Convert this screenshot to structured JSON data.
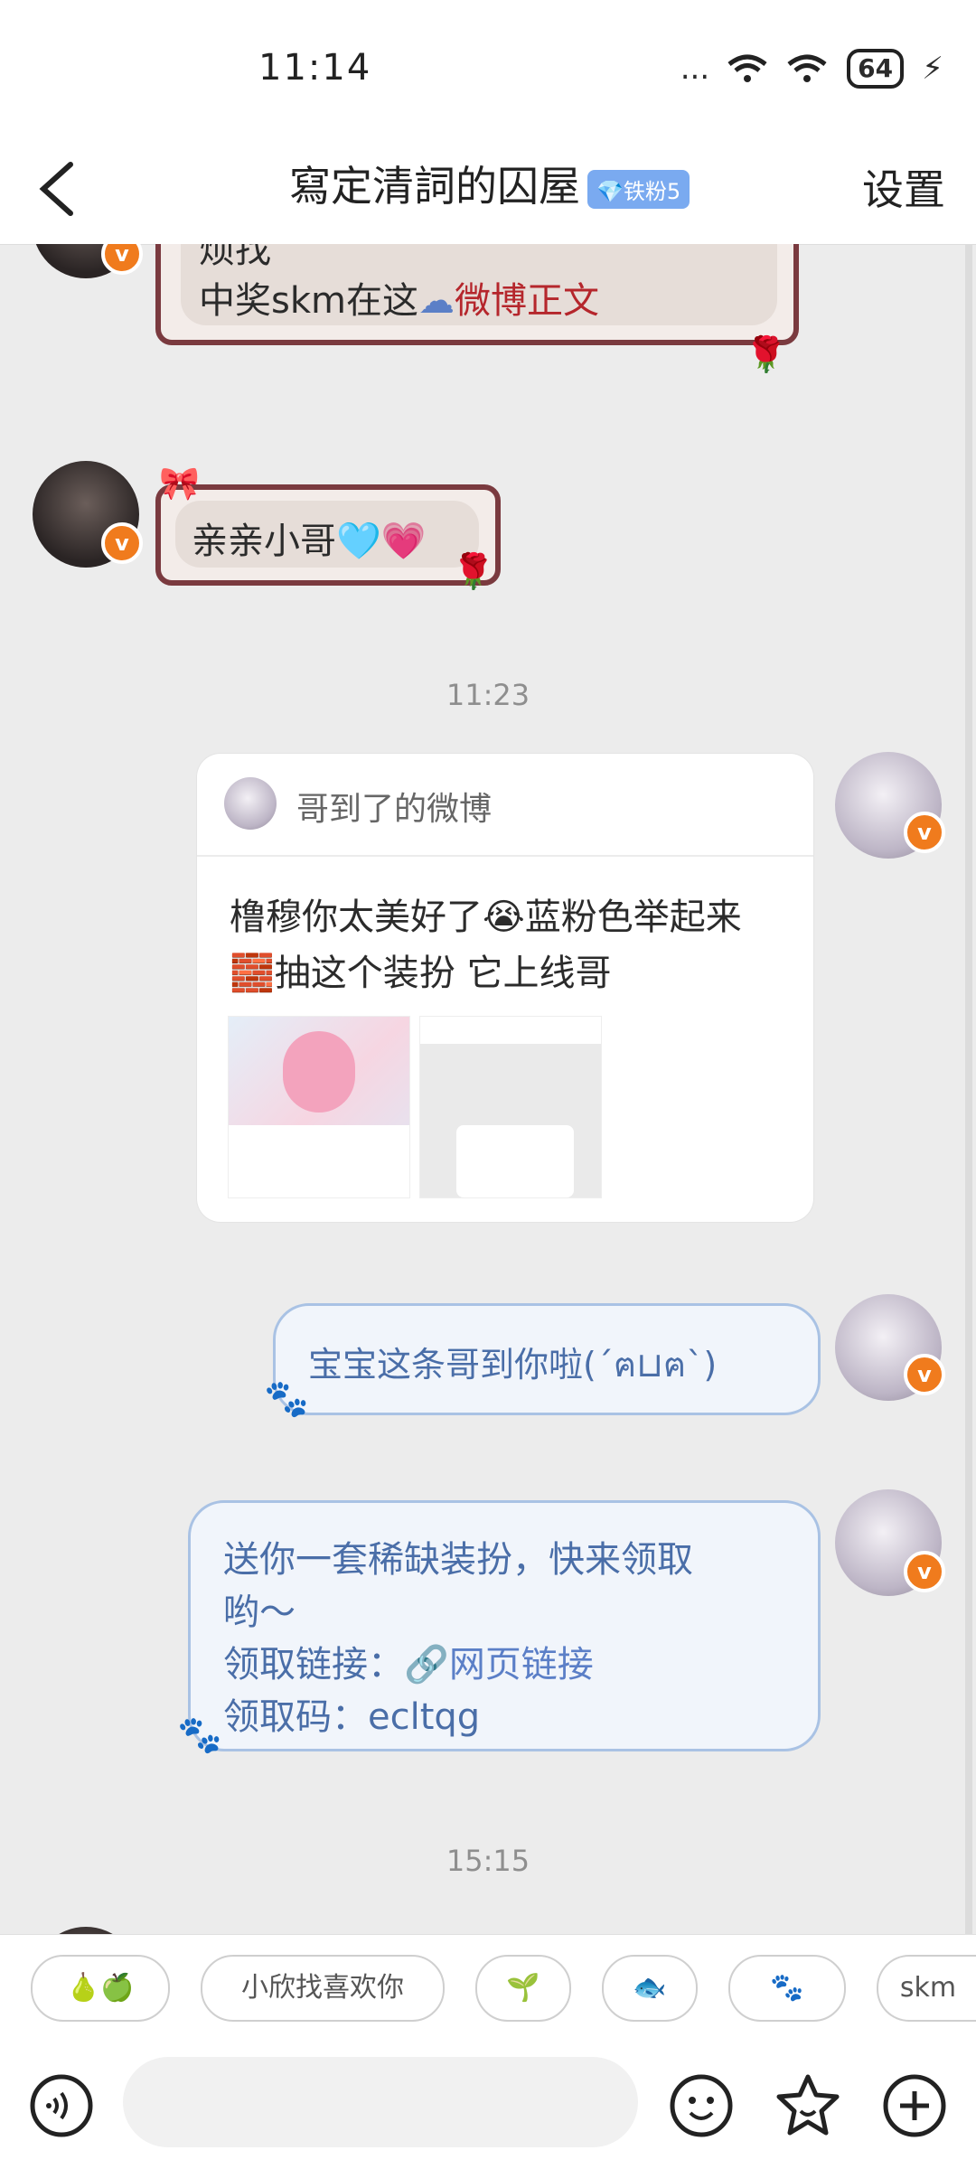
{
  "status_bar": {
    "time": "11:14",
    "dots": "...",
    "battery": "64"
  },
  "header": {
    "title": "寫定清詞的囚屋",
    "badge": "铁粉5",
    "settings_label": "设置"
  },
  "messages": {
    "prev_frame": {
      "line1": "烦找",
      "line2": "中奖skm在这",
      "link": "微博正文"
    },
    "reply_frame": {
      "text": "亲亲小哥",
      "emoji": "🩵💗"
    },
    "timestamp_1": "11:23",
    "shared_post": {
      "header": "哥到了的微博",
      "text_line1": "橹穆你太美好了😭蓝粉色举起来",
      "text_line2": "🧱抽这个装扮 它上线哥"
    },
    "bubble_1": {
      "text": "宝宝这条哥到你啦(´ฅ⊔ฅ`)"
    },
    "bubble_2": {
      "line1": "送你一套稀缺装扮，快来领取",
      "line2": "哟～",
      "link_label": "领取链接：",
      "link_text": "网页链接",
      "code_label": "领取码：",
      "code": "ecltqg"
    },
    "timestamp_2": "15:15"
  },
  "quick_replies": [
    "🍐🍏",
    "小欣找喜欢你",
    "🌱",
    "🐟",
    "🐾",
    "skm"
  ],
  "colors": {
    "accent_orange": "#f07b1d",
    "frame_maroon": "#7a3a3f",
    "bubble_blue": "#a9c2e4",
    "link_blue": "#5b7fc7"
  }
}
